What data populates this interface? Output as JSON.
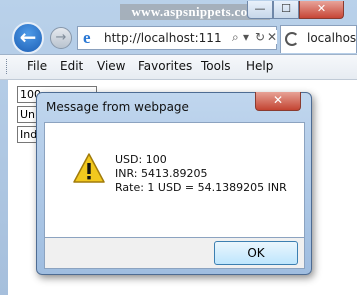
{
  "window": {
    "watermark": "www.aspsnippets.com",
    "minimize_glyph": "—",
    "maximize_glyph": "☐",
    "close_glyph": "✕"
  },
  "nav": {
    "back_glyph": "←",
    "forward_glyph": "→",
    "address_url": "http://localhost:111",
    "page_icon_glyph": "e",
    "search_glyph": "⌕",
    "dropdown_glyph": "▾",
    "refresh_glyph": "↻",
    "stop_glyph": "✕",
    "tab_label": "localhos"
  },
  "menubar": {
    "items": [
      "File",
      "Edit",
      "View",
      "Favorites",
      "Tools",
      "Help"
    ]
  },
  "page": {
    "fields": [
      "100",
      "Un",
      "Ind"
    ]
  },
  "dialog": {
    "title": "Message from webpage",
    "close_glyph": "✕",
    "lines": [
      "USD: 100",
      "INR: 5413.89205",
      "Rate: 1 USD = 54.1389205 INR"
    ],
    "ok_label": "OK"
  },
  "colors": {
    "warning_yellow": "#f2c81e",
    "accent_blue": "#1d5fb5",
    "close_red": "#c74636"
  }
}
